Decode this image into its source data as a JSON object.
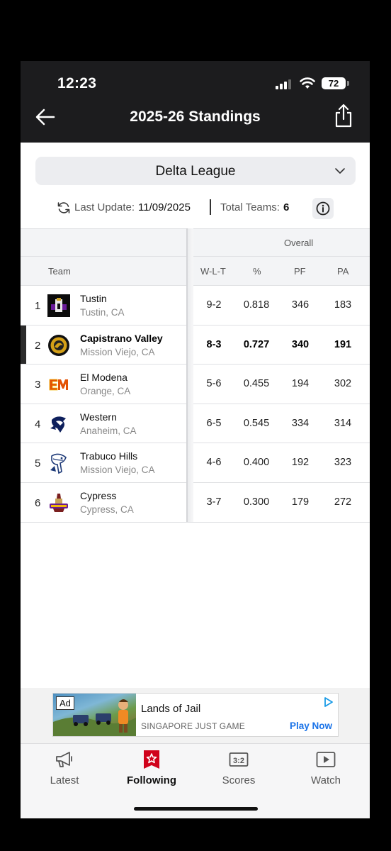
{
  "status_bar": {
    "time": "12:23",
    "battery": "72"
  },
  "header": {
    "title": "2025-26 Standings"
  },
  "league_selector": {
    "selected": "Delta League"
  },
  "info": {
    "last_update_label": "Last Update:",
    "last_update_value": "11/09/2025",
    "total_teams_label": "Total Teams:",
    "total_teams_value": "6"
  },
  "table": {
    "group_header": "Overall",
    "columns": {
      "team": "Team",
      "wlt": "W-L-T",
      "pct": "%",
      "pf": "PF",
      "pa": "PA"
    },
    "rows": [
      {
        "rank": "1",
        "name": "Tustin",
        "location": "Tustin, CA",
        "wlt": "9-2",
        "pct": "0.818",
        "pf": "346",
        "pa": "183"
      },
      {
        "rank": "2",
        "name": "Capistrano Valley",
        "location": "Mission Viejo, CA",
        "wlt": "8-3",
        "pct": "0.727",
        "pf": "340",
        "pa": "191"
      },
      {
        "rank": "3",
        "name": "El Modena",
        "location": "Orange, CA",
        "wlt": "5-6",
        "pct": "0.455",
        "pf": "194",
        "pa": "302"
      },
      {
        "rank": "4",
        "name": "Western",
        "location": "Anaheim, CA",
        "wlt": "6-5",
        "pct": "0.545",
        "pf": "334",
        "pa": "314"
      },
      {
        "rank": "5",
        "name": "Trabuco Hills",
        "location": "Mission Viejo, CA",
        "wlt": "4-6",
        "pct": "0.400",
        "pf": "192",
        "pa": "323"
      },
      {
        "rank": "6",
        "name": "Cypress",
        "location": "Cypress, CA",
        "wlt": "3-7",
        "pct": "0.300",
        "pf": "179",
        "pa": "272"
      }
    ]
  },
  "ad": {
    "badge": "Ad",
    "title": "Lands of Jail",
    "subtitle": "SINGAPORE JUST GAME",
    "cta": "Play Now"
  },
  "tabs": [
    {
      "label": "Latest",
      "icon": "megaphone-icon"
    },
    {
      "label": "Following",
      "icon": "star-icon"
    },
    {
      "label": "Scores",
      "icon": "scoreboard-icon"
    },
    {
      "label": "Watch",
      "icon": "play-icon"
    }
  ],
  "colors": {
    "header_bg": "#1c1c1e",
    "accent_red": "#d0021b",
    "link_blue": "#1a73e8"
  }
}
